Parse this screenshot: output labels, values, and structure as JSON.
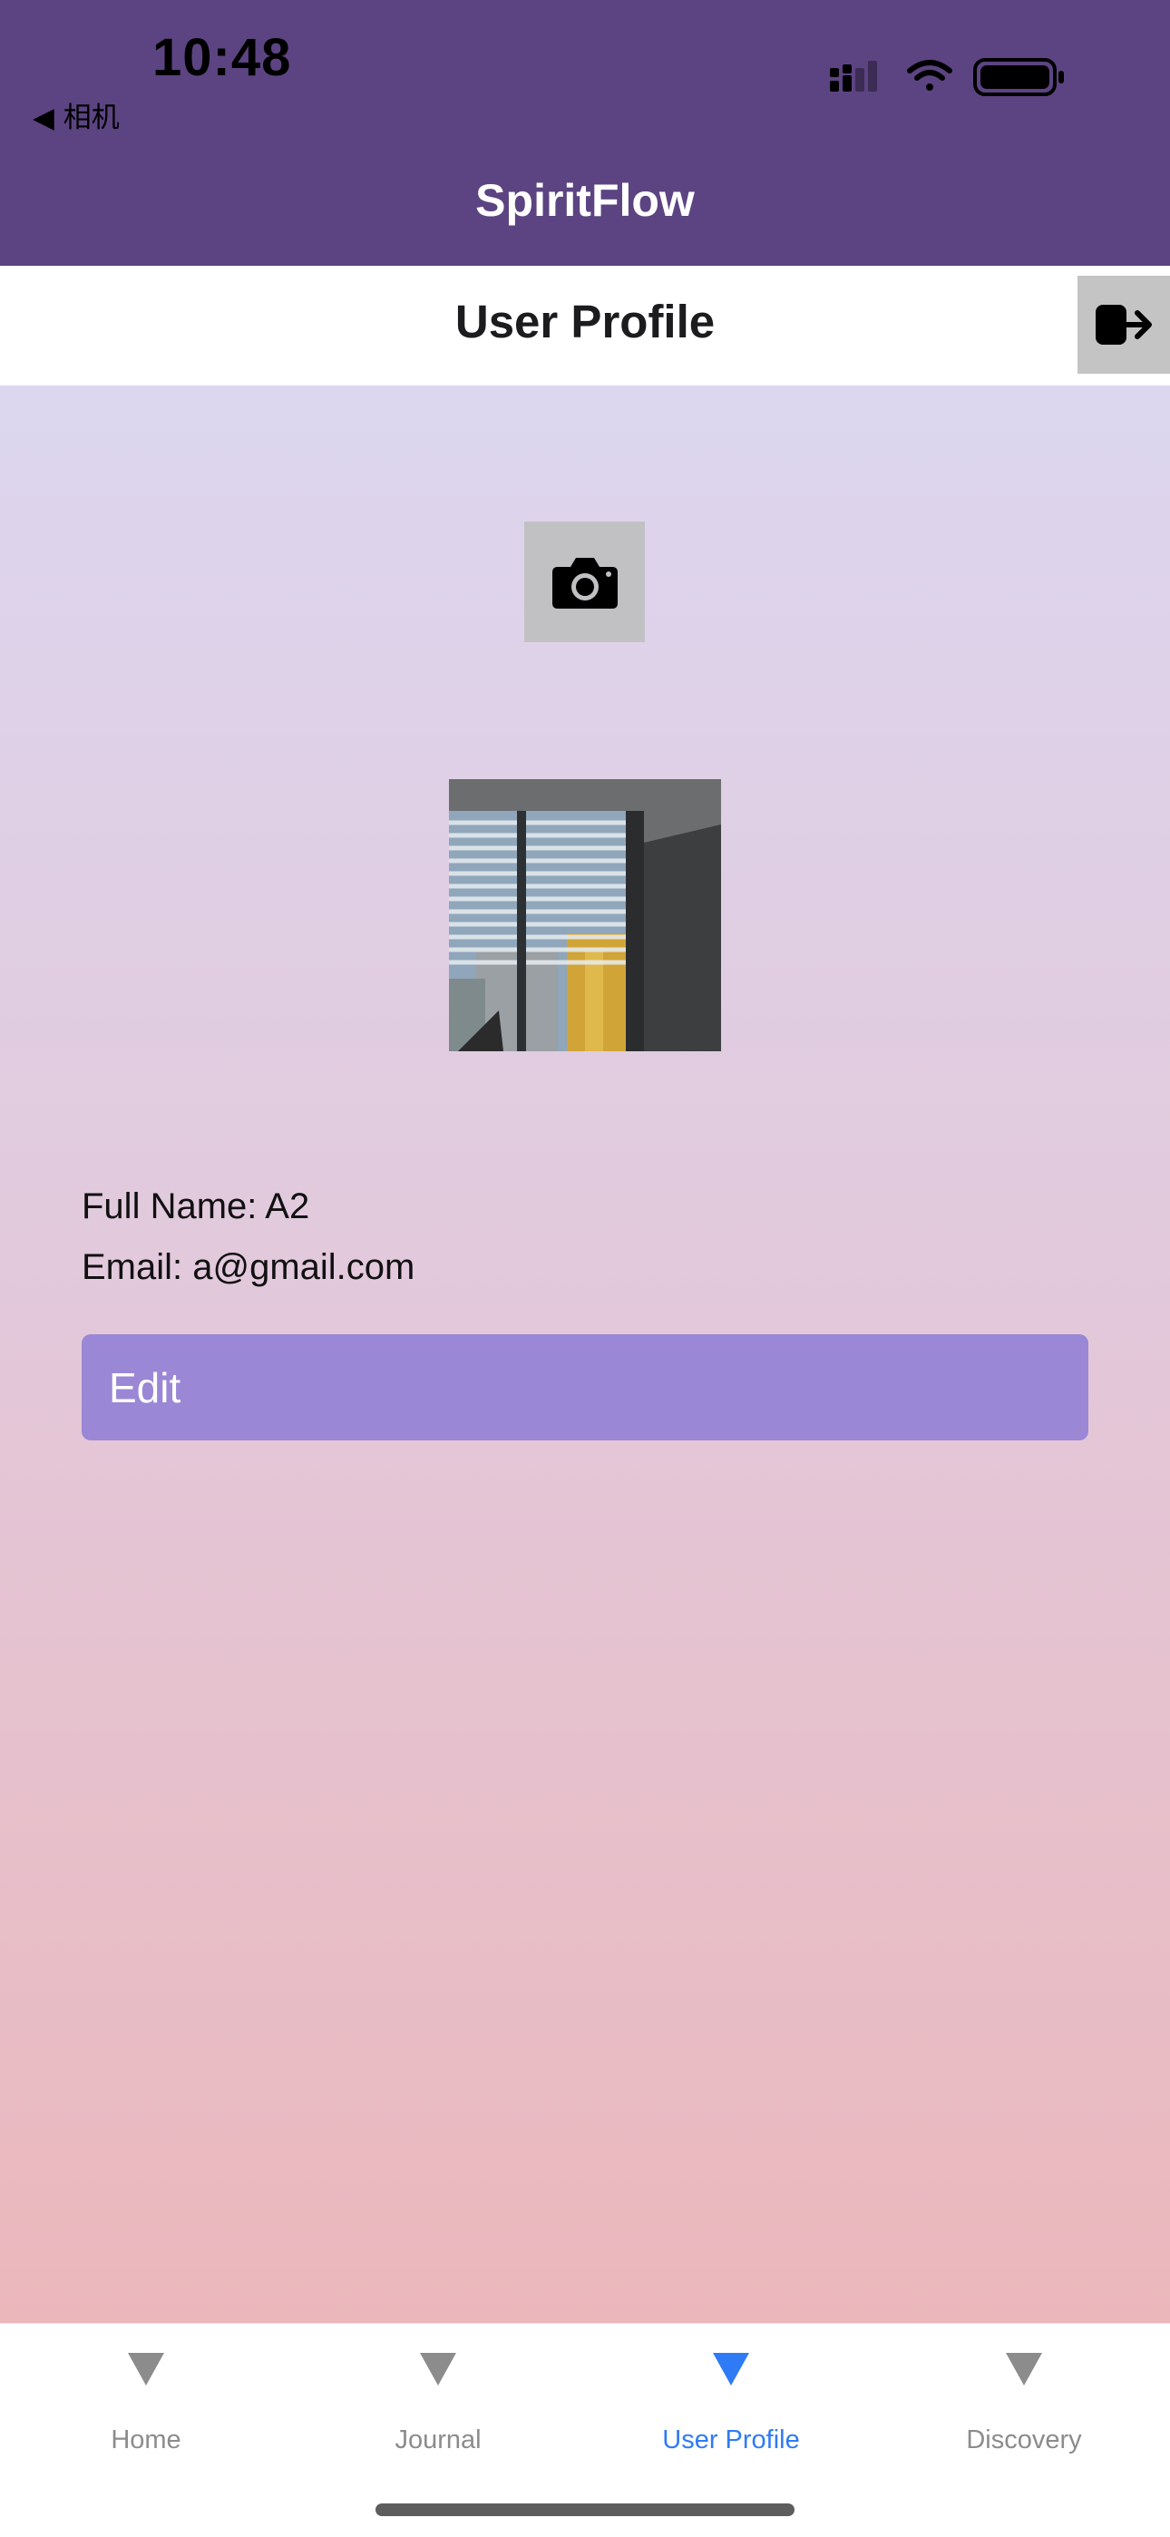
{
  "status_bar": {
    "time": "10:48",
    "back_label": "◀ 相机"
  },
  "header": {
    "app_title": "SpiritFlow"
  },
  "page": {
    "title": "User Profile",
    "logout_icon": "logout-icon"
  },
  "profile": {
    "camera_icon": "camera-icon",
    "full_name_line": "Full Name: A2",
    "email_line": "Email: a@gmail.com",
    "edit_label": "Edit"
  },
  "tabs": [
    {
      "label": "Home",
      "active": false
    },
    {
      "label": "Journal",
      "active": false
    },
    {
      "label": "User Profile",
      "active": true
    },
    {
      "label": "Discovery",
      "active": false
    }
  ],
  "colors": {
    "header_bg": "#5c4482",
    "edit_button": "#9a87d6",
    "active_tab": "#2f7bf5",
    "inactive_tab": "#8c8c8c"
  }
}
